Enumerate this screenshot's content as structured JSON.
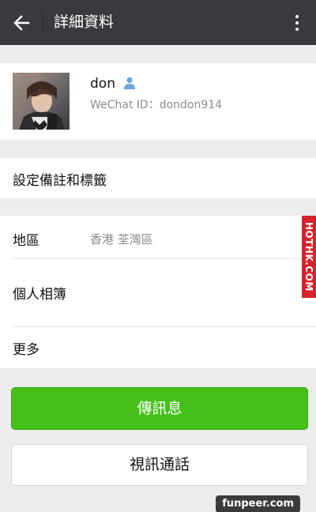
{
  "header": {
    "title": "詳細資料",
    "back_icon": "arrow-left-icon",
    "more_icon": "more-vertical-icon"
  },
  "profile": {
    "name": "don",
    "wechat_id": "WeChat ID：dondon914",
    "badge_icon": "contact-person-icon"
  },
  "rows": {
    "remark_label": "設定備註和標籤",
    "region_label": "地區",
    "region_value": "香港  荃灣區",
    "album_label": "個人相簿",
    "more_label": "更多"
  },
  "actions": {
    "message_label": "傳訊息",
    "video_call_label": "視訊通話"
  },
  "watermarks": {
    "side": "HOTHK.COM",
    "bottom": "funpeer.com"
  },
  "colors": {
    "topbar": "#393a3f",
    "primary_button": "#45c01a",
    "background": "#ececec",
    "watermark_red": "#d8232a"
  }
}
